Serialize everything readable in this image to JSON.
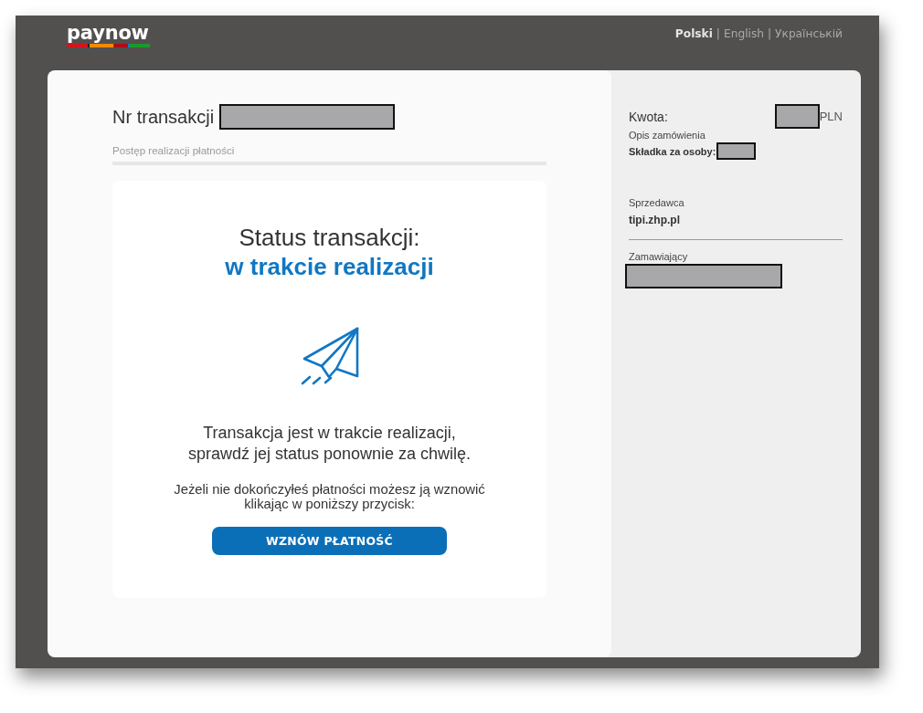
{
  "header": {
    "logo": "paynow",
    "languages": [
      {
        "label": "Polski",
        "selected": true,
        "separator": "|"
      },
      {
        "label": "English",
        "selected": false,
        "separator": "|"
      },
      {
        "label": "Українській",
        "selected": false
      }
    ]
  },
  "transaction": {
    "label": "Nr transakcji",
    "redacted": true,
    "progress": {
      "label": "Postęp realizacji płatności"
    }
  },
  "status": {
    "title": "Status transakcji:",
    "value": "w trakcie realizacji",
    "message": "Transakcja jest w trakcie realizacji,\nsprawdź jej status ponownie za chwilę.",
    "hint": "Jeżeli nie dokończyłeś płatności możesz ją wznowić\nklikając w poniższy przycisk:",
    "button": "WZNÓW PŁATNOŚĆ"
  },
  "summary": {
    "amount": {
      "label": "Kwota:",
      "redacted": true,
      "currency": "PLN"
    },
    "description": {
      "label": "Opis zamówienia",
      "text": "Składka za osoby:",
      "redacted": true
    },
    "seller": {
      "label": "Sprzedawca",
      "value": "tipi.zhp.pl"
    },
    "buyer": {
      "label": "Zamawiający",
      "redacted": true
    }
  }
}
